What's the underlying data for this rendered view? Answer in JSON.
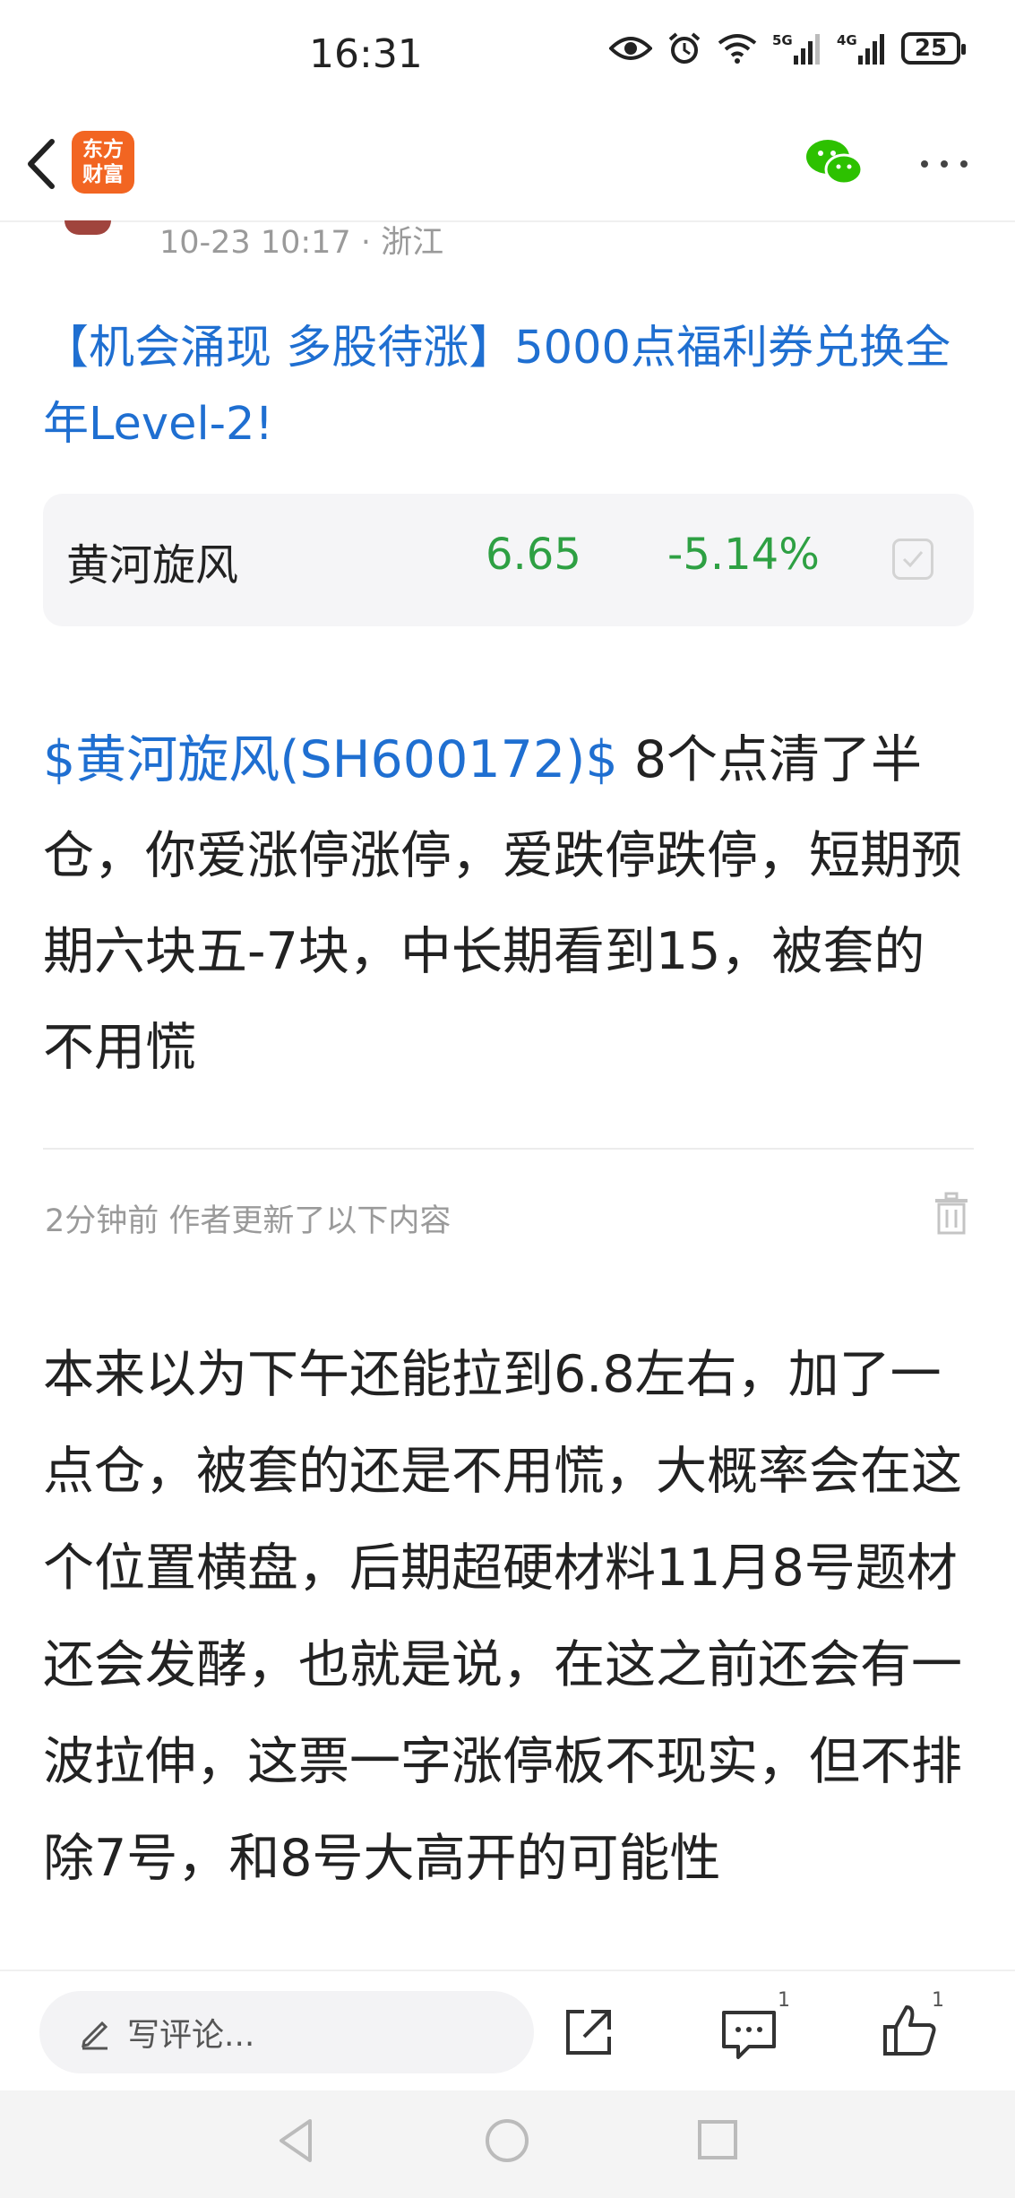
{
  "status_bar": {
    "time": "16:31",
    "battery": "25",
    "icons": [
      "eye-icon",
      "alarm-icon",
      "wifi-icon",
      "5g-signal-icon",
      "4g-signal-icon",
      "battery-icon"
    ],
    "signal_labels": [
      "5G",
      "4G"
    ]
  },
  "header": {
    "logo_text_line1": "东方",
    "logo_text_line2": "财富",
    "brand_color": "#f26522"
  },
  "post": {
    "meta": "10-23 10:17 · 浙江",
    "promo": "【机会涌现 多股待涨】5000点福利券兑换全年Level-2!",
    "stock_card": {
      "name": "黄河旋风",
      "price": "6.65",
      "change": "-5.14%",
      "color": "#2ea043"
    },
    "stock_tag": "$黄河旋风(SH600172)$",
    "main_text": " 8个点清了半仓，你爱涨停涨停，爱跌停跌停，短期预期六块五-7块，中长期看到15，被套的不用慌",
    "update_note": "2分钟前  作者更新了以下内容",
    "update_text": "本来以为下午还能拉到6.8左右，加了一点仓，被套的还是不用慌，大概率会在这个位置横盘，后期超硬材料11月8号题材还会发酵，也就是说，在这之前还会有一波拉伸，这票一字涨停板不现实，但不排除7号，和8号大高开的可能性"
  },
  "bottom_bar": {
    "comment_placeholder": "写评论...",
    "comment_count": "1",
    "like_count": "1"
  },
  "colors": {
    "link_blue": "#1f6fd1",
    "text": "#222222",
    "muted": "#9a9a9a"
  }
}
